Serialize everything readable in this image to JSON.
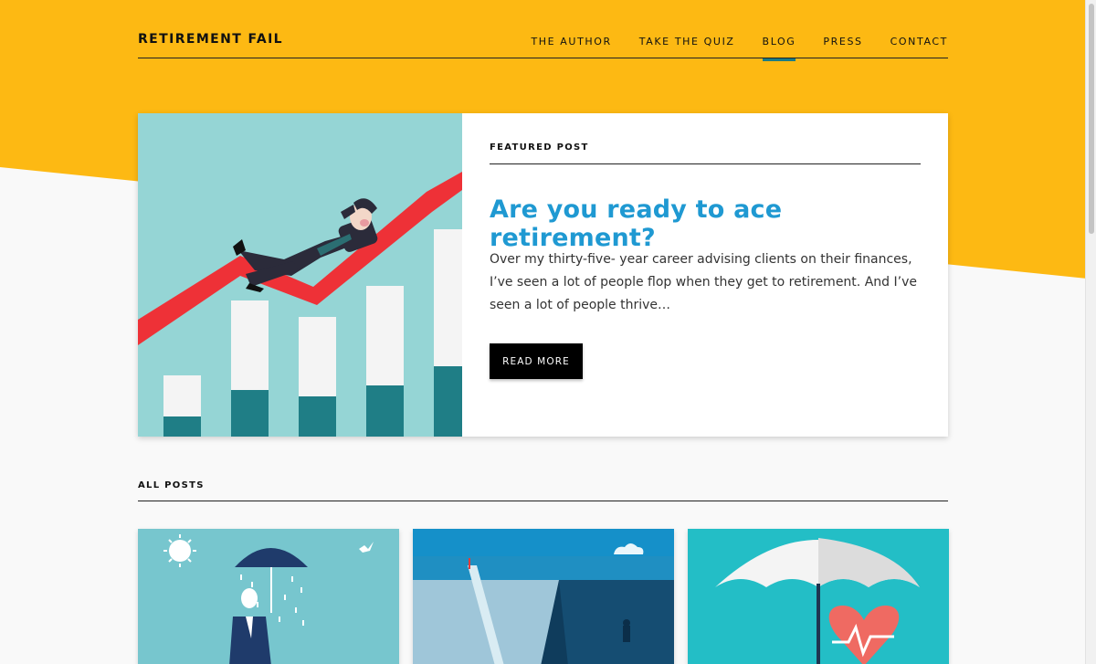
{
  "site": {
    "title": "RETIREMENT FAIL"
  },
  "nav": {
    "items": [
      {
        "label": "THE AUTHOR"
      },
      {
        "label": "TAKE THE QUIZ"
      },
      {
        "label": "BLOG"
      },
      {
        "label": "PRESS"
      },
      {
        "label": "CONTACT"
      }
    ],
    "active": "BLOG"
  },
  "featured": {
    "label": "FEATURED POST",
    "title": "Are you ready to ace retirement?",
    "excerpt": "Over my thirty-five- year career advising clients on their finances, I’ve seen a lot of people flop when they get to retirement. And I’ve seen a lot of people thrive…",
    "button": "READ MORE",
    "image": "businessman-relaxing-on-rising-chart-illustration"
  },
  "all_posts": {
    "label": "ALL POSTS",
    "cards": [
      {
        "image": "businessman-under-rain-umbrella-illustration"
      },
      {
        "image": "person-facing-chasm-bridge-illustration"
      },
      {
        "image": "umbrella-over-heart-illustration"
      }
    ]
  },
  "colors": {
    "yellow": "#fdb913",
    "accent_blue": "#1f99d2",
    "teal": "#1c7c84",
    "image_bg": "#95d5d5",
    "chart_red": "#ee3137",
    "button_bg": "#000000",
    "page_bg": "#f9f9f9"
  }
}
